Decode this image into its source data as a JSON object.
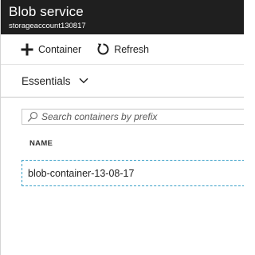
{
  "blade": {
    "title": "Blob service",
    "subtitle": "storageaccount130817"
  },
  "toolbar": {
    "add_container_label": "Container",
    "add_container_icon": "plus-icon",
    "refresh_label": "Refresh",
    "refresh_icon": "refresh-icon"
  },
  "essentials": {
    "label": "Essentials",
    "icon": "chevron-down-icon"
  },
  "search": {
    "placeholder": "Search containers by prefix",
    "value": "",
    "icon": "search-icon"
  },
  "table": {
    "columns": [
      "NAME"
    ],
    "rows": [
      {
        "name": "blob-container-13-08-17"
      }
    ]
  },
  "colors": {
    "header_bg": "#1f1f1f",
    "header_text": "#ffffff",
    "selection_border": "#3aa0c8"
  }
}
